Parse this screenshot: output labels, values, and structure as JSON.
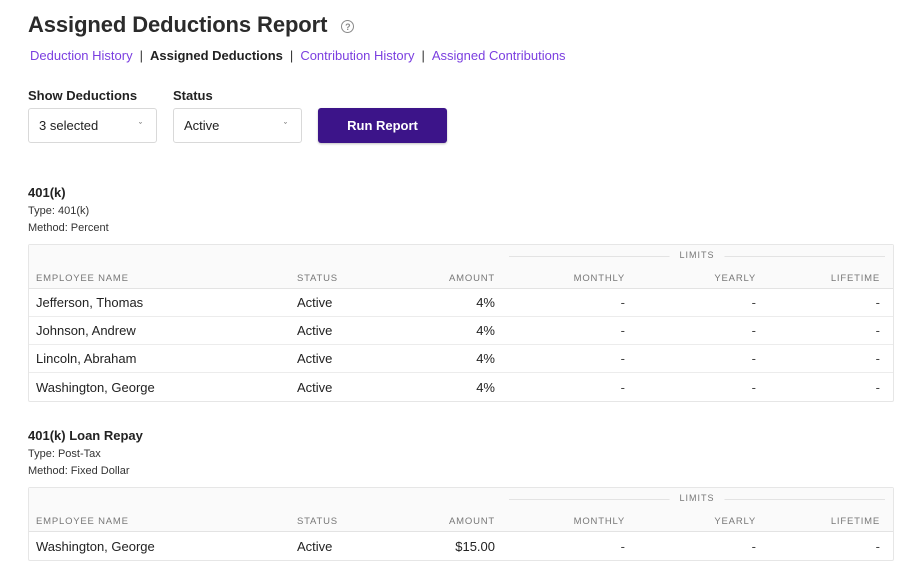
{
  "header": {
    "title": "Assigned Deductions Report",
    "help_icon": "?"
  },
  "subnav": {
    "items": [
      {
        "label": "Deduction History",
        "current": false
      },
      {
        "label": "Assigned Deductions",
        "current": true
      },
      {
        "label": "Contribution History",
        "current": false
      },
      {
        "label": "Assigned Contributions",
        "current": false
      }
    ],
    "separator": "|"
  },
  "filters": {
    "show_deductions": {
      "label": "Show Deductions",
      "value": "3 selected"
    },
    "status": {
      "label": "Status",
      "value": "Active"
    },
    "run_button": "Run Report",
    "chevron": "ˇ"
  },
  "columns": {
    "limits": "LIMITS",
    "employee": "EMPLOYEE NAME",
    "status": "STATUS",
    "amount": "AMOUNT",
    "monthly": "MONTHLY",
    "yearly": "YEARLY",
    "lifetime": "LIFETIME"
  },
  "sections": [
    {
      "title": "401(k)",
      "type": "Type: 401(k)",
      "method": "Method: Percent",
      "rows": [
        {
          "name": "Jefferson, Thomas",
          "status": "Active",
          "amount": "4%",
          "monthly": "-",
          "yearly": "-",
          "lifetime": "-"
        },
        {
          "name": "Johnson, Andrew",
          "status": "Active",
          "amount": "4%",
          "monthly": "-",
          "yearly": "-",
          "lifetime": "-"
        },
        {
          "name": "Lincoln, Abraham",
          "status": "Active",
          "amount": "4%",
          "monthly": "-",
          "yearly": "-",
          "lifetime": "-"
        },
        {
          "name": "Washington, George",
          "status": "Active",
          "amount": "4%",
          "monthly": "-",
          "yearly": "-",
          "lifetime": "-"
        }
      ]
    },
    {
      "title": "401(k) Loan Repay",
      "type": "Type: Post-Tax",
      "method": "Method: Fixed Dollar",
      "rows": [
        {
          "name": "Washington, George",
          "status": "Active",
          "amount": "$15.00",
          "monthly": "-",
          "yearly": "-",
          "lifetime": "-"
        }
      ]
    }
  ],
  "colors": {
    "link": "#7b3fe0",
    "primary_button": "#3c1489"
  }
}
